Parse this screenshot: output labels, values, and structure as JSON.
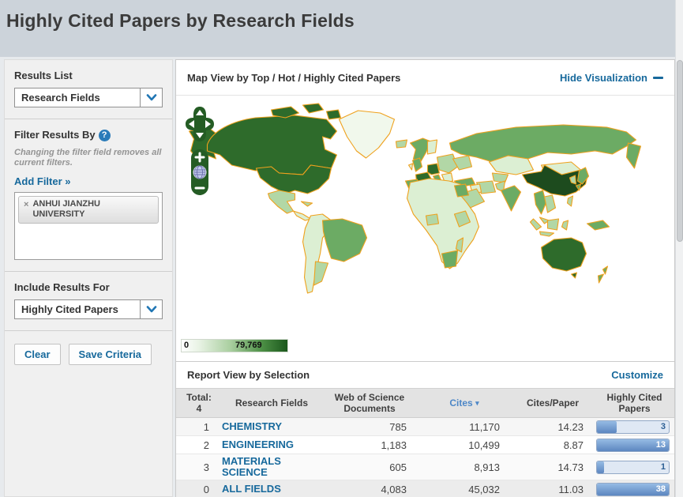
{
  "page": {
    "title": "Highly Cited Papers by Research Fields"
  },
  "sidebar": {
    "results_list_label": "Results List",
    "results_list_value": "Research Fields",
    "filter_label": "Filter Results By",
    "filter_help": "?",
    "filter_note": "Changing the filter field removes all current filters.",
    "add_filter": "Add Filter »",
    "filter_tag": {
      "remove": "×",
      "label": "ANHUI JIANZHU UNIVERSITY"
    },
    "include_label": "Include Results For",
    "include_value": "Highly Cited Papers",
    "clear_button": "Clear",
    "save_button": "Save Criteria"
  },
  "map_panel": {
    "title": "Map View by Top / Hot / Highly Cited Papers",
    "hide_link": "Hide Visualization",
    "zoom_in": "+",
    "zoom_out": "−",
    "legend": {
      "min": "0",
      "max": "79,769"
    }
  },
  "map": {
    "palette": {
      "border": "#efa11d",
      "level0": "#f1f8ec",
      "level1": "#dcefd3",
      "level2": "#b2d7a6",
      "level3": "#6cab64",
      "level4": "#2e6b2b",
      "level5": "#1d4b1e",
      "control": "#245c24"
    }
  },
  "report": {
    "title": "Report View by Selection",
    "customize": "Customize",
    "table": {
      "total_label": "Total:",
      "total_value": "4",
      "col_fields": "Research Fields",
      "col_docs": "Web of Science Documents",
      "col_cites": "Cites",
      "col_cites_caret": "▾",
      "col_cpp": "Cites/Paper",
      "col_hcp": "Highly Cited Papers",
      "rows": [
        {
          "rank": "1",
          "field": "CHEMISTRY",
          "docs": "785",
          "cites": "11,170",
          "cpp": "14.23",
          "hcp": "3",
          "bar_pct": 27
        },
        {
          "rank": "2",
          "field": "ENGINEERING",
          "docs": "1,183",
          "cites": "10,499",
          "cpp": "8.87",
          "hcp": "13",
          "bar_pct": 100
        },
        {
          "rank": "3",
          "field": "MATERIALS SCIENCE",
          "docs": "605",
          "cites": "8,913",
          "cpp": "14.73",
          "hcp": "1",
          "bar_pct": 10
        },
        {
          "rank": "0",
          "field": "ALL FIELDS",
          "docs": "4,083",
          "cites": "45,032",
          "cpp": "11.03",
          "hcp": "38",
          "bar_pct": 100
        }
      ]
    }
  },
  "colors": {
    "header_bg": "#ccd3da",
    "link": "#17699c",
    "sort_link": "#4d87c7",
    "bar_track": "#dfe8f4",
    "bar_fill_top": "#96bbe4",
    "bar_fill_bottom": "#5c86c0"
  }
}
